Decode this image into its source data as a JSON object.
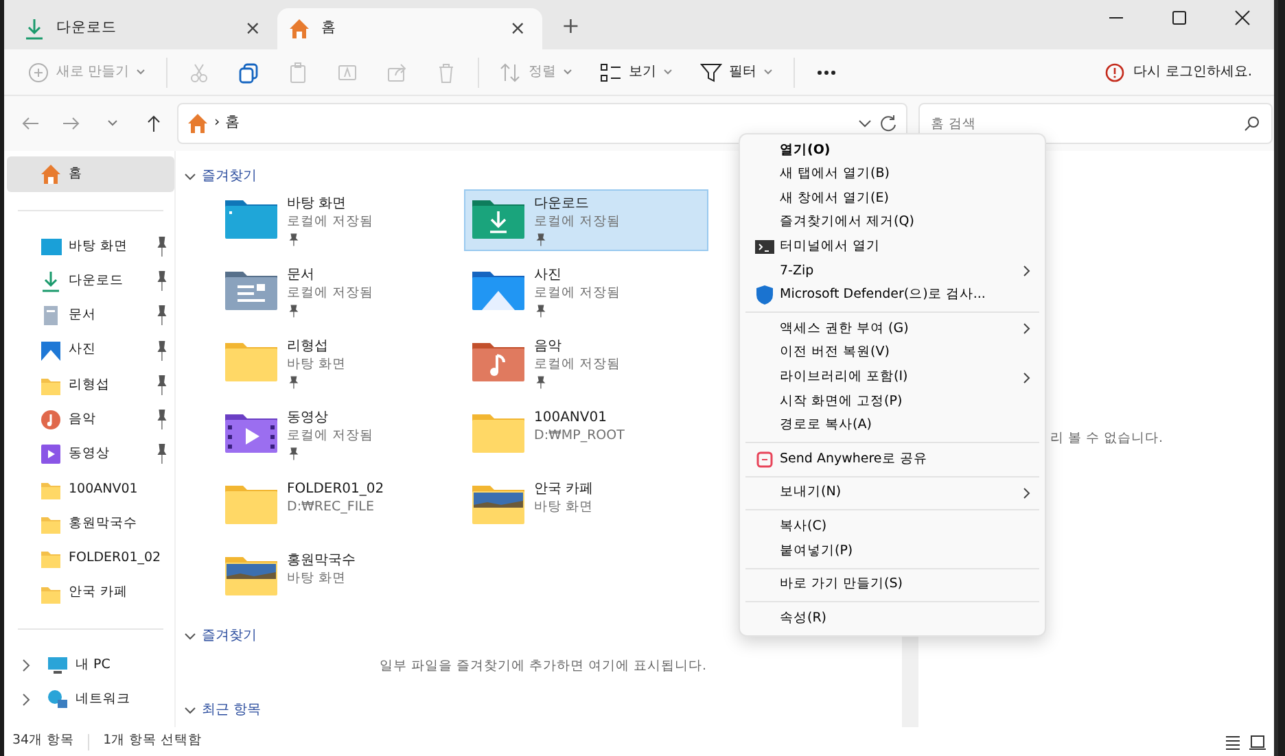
{
  "tabs": [
    {
      "label": "다운로드",
      "kind": "download",
      "selected": false,
      "close": "×"
    },
    {
      "label": "홈",
      "kind": "home",
      "selected": true,
      "close": "×"
    }
  ],
  "new_tab": "+",
  "toolbar": [
    {
      "kind": "new",
      "label": "새로 만들기",
      "disabled": true,
      "dropdown": true
    },
    {
      "kind": "sep"
    },
    {
      "kind": "cut",
      "disabled": true
    },
    {
      "kind": "copy",
      "disabled": false
    },
    {
      "kind": "paste",
      "disabled": true
    },
    {
      "kind": "rename",
      "disabled": true
    },
    {
      "kind": "share",
      "disabled": true
    },
    {
      "kind": "delete",
      "disabled": true
    },
    {
      "kind": "sep"
    },
    {
      "kind": "sort",
      "label": "정렬",
      "disabled": true,
      "dropdown": true
    },
    {
      "kind": "view",
      "label": "보기",
      "disabled": false,
      "dropdown": true
    },
    {
      "kind": "filter",
      "label": "필터",
      "disabled": false,
      "dropdown": true
    },
    {
      "kind": "sep"
    },
    {
      "kind": "more",
      "disabled": false
    }
  ],
  "notice": "다시 로그인하세요.",
  "address": {
    "path": "홈",
    "separator": "›"
  },
  "search": {
    "placeholder": "홈 검색"
  },
  "sidebar": {
    "home": {
      "label": "홈",
      "selected": true
    },
    "pinned": [
      {
        "label": "바탕 화면",
        "kind": "desktop",
        "pinned": true
      },
      {
        "label": "다운로드",
        "kind": "download",
        "pinned": true
      },
      {
        "label": "문서",
        "kind": "documents",
        "pinned": true
      },
      {
        "label": "사진",
        "kind": "pictures",
        "pinned": true
      },
      {
        "label": "리형섭",
        "kind": "folder",
        "pinned": true
      },
      {
        "label": "음악",
        "kind": "music",
        "pinned": true
      },
      {
        "label": "동영상",
        "kind": "videos",
        "pinned": true
      },
      {
        "label": "100ANV01",
        "kind": "folder",
        "pinned": false
      },
      {
        "label": "홍원막국수",
        "kind": "folder",
        "pinned": false
      },
      {
        "label": "FOLDER01_02",
        "kind": "folder",
        "pinned": false
      },
      {
        "label": "안국 카페",
        "kind": "folder",
        "pinned": false
      }
    ],
    "locations": [
      {
        "label": "내 PC",
        "kind": "pc",
        "expanded": false
      },
      {
        "label": "네트워크",
        "kind": "network",
        "expanded": false
      }
    ]
  },
  "sections": [
    {
      "title": "즐겨찾기",
      "expanded": true,
      "items": [
        {
          "name": "바탕 화면",
          "detail": "로컬에 저장됨",
          "kind": "desktop",
          "pinned": true,
          "selected": false
        },
        {
          "name": "다운로드",
          "detail": "로컬에 저장됨",
          "kind": "download",
          "pinned": true,
          "selected": true
        },
        {
          "name": "문서",
          "detail": "로컬에 저장됨",
          "kind": "documents",
          "pinned": true,
          "selected": false
        },
        {
          "name": "사진",
          "detail": "로컬에 저장됨",
          "kind": "pictures",
          "pinned": true,
          "selected": false
        },
        {
          "name": "리형섭",
          "detail": "바탕 화면",
          "kind": "folder",
          "pinned": true,
          "selected": false
        },
        {
          "name": "음악",
          "detail": "로컬에 저장됨",
          "kind": "music",
          "pinned": true,
          "selected": false
        },
        {
          "name": "동영상",
          "detail": "로컬에 저장됨",
          "kind": "videos",
          "pinned": true,
          "selected": false
        },
        {
          "name": "100ANV01",
          "detail": "D:₩MP_ROOT",
          "kind": "folder",
          "pinned": false,
          "selected": false
        },
        {
          "name": "FOLDER01_02",
          "detail": "D:₩REC_FILE",
          "kind": "folder",
          "pinned": false,
          "selected": false
        },
        {
          "name": "안국 카페",
          "detail": "바탕 화면",
          "kind": "photo-folder",
          "pinned": false,
          "selected": false
        },
        {
          "name": "홍원막국수",
          "detail": "바탕 화면",
          "kind": "photo-folder",
          "pinned": false,
          "selected": false
        }
      ]
    },
    {
      "title": "즐겨찾기",
      "expanded": true,
      "empty_text": "일부 파일을 즐겨찾기에 추가하면 여기에 표시됩니다."
    },
    {
      "title": "최근 항목",
      "expanded": true
    }
  ],
  "preview": {
    "message": "리 볼 수 없습니다."
  },
  "context_menu": [
    {
      "kind": "item",
      "label": "열기(O)",
      "default": true
    },
    {
      "kind": "item",
      "label": "새 탭에서 열기(B)"
    },
    {
      "kind": "item",
      "label": "새 창에서 열기(E)"
    },
    {
      "kind": "item",
      "label": "즐겨찾기에서 제거(Q)"
    },
    {
      "kind": "terminal",
      "label": "터미널에서 열기"
    },
    {
      "kind": "item",
      "label": "7-Zip",
      "submenu": true
    },
    {
      "kind": "shield",
      "label": "Microsoft Defender(으)로 검사..."
    },
    {
      "kind": "sep"
    },
    {
      "kind": "item",
      "label": "액세스 권한 부여 (G)",
      "submenu": true
    },
    {
      "kind": "item",
      "label": "이전 버전 복원(V)"
    },
    {
      "kind": "item",
      "label": "라이브러리에 포함(I)",
      "submenu": true
    },
    {
      "kind": "item",
      "label": "시작 화면에 고정(P)"
    },
    {
      "kind": "item",
      "label": "경로로 복사(A)"
    },
    {
      "kind": "sep"
    },
    {
      "kind": "send",
      "label": "Send Anywhere로 공유"
    },
    {
      "kind": "sep"
    },
    {
      "kind": "item",
      "label": "보내기(N)",
      "submenu": true
    },
    {
      "kind": "sep"
    },
    {
      "kind": "item",
      "label": "복사(C)"
    },
    {
      "kind": "item",
      "label": "붙여넣기(P)"
    },
    {
      "kind": "sep"
    },
    {
      "kind": "item",
      "label": "바로 가기 만들기(S)"
    },
    {
      "kind": "sep"
    },
    {
      "kind": "item",
      "label": "속성(R)"
    }
  ],
  "status_bar": {
    "count": "34개 항목",
    "selection": "1개 항목 선택함"
  }
}
